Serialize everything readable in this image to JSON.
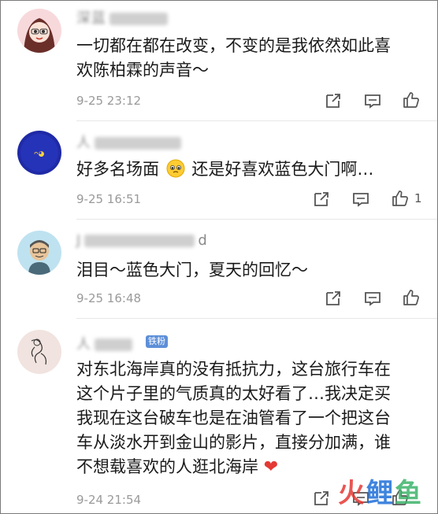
{
  "comments": [
    {
      "name": "深蓝",
      "text_lines": [
        "一切都在都在改变，不变的是我依然如此喜",
        "欢陈柏霖的声音～"
      ],
      "time": "9-25 23:12",
      "likes": ""
    },
    {
      "name": "人",
      "text_before_emoji": "好多名场面",
      "emoji": "pleading-face-emoji",
      "text_after_emoji": "还是好喜欢蓝色大门啊…",
      "time": "9-25 16:51",
      "likes": "1"
    },
    {
      "name": "J",
      "name_tail": "d",
      "text_lines": [
        "泪目～蓝色大门，夏天的回忆～"
      ],
      "time": "9-25 16:48",
      "likes": ""
    },
    {
      "name": "人",
      "badge": "铁粉",
      "text_lines": [
        "对东北海岸真的没有抵抗力，这台旅行车在",
        "这个片子里的气质真的太好看了…我决定买",
        "我现在这台破车也是在油管看了一个把这台",
        "车从淡水开到金山的影片，直接分加满，谁"
      ],
      "last_line": "不想载喜欢的人逛北海岸",
      "last_emoji": "❤",
      "time": "9-24 21:54",
      "likes": ""
    }
  ],
  "icons": {
    "share": "share-icon",
    "reply": "comment-icon",
    "like": "thumbs-up-icon"
  },
  "watermark": {
    "a": "火",
    "b": "鲤",
    "c": "鱼"
  },
  "colors": {
    "meta": "#9a9a9a",
    "badge": "#5d8fd8",
    "heart": "#e53935"
  }
}
